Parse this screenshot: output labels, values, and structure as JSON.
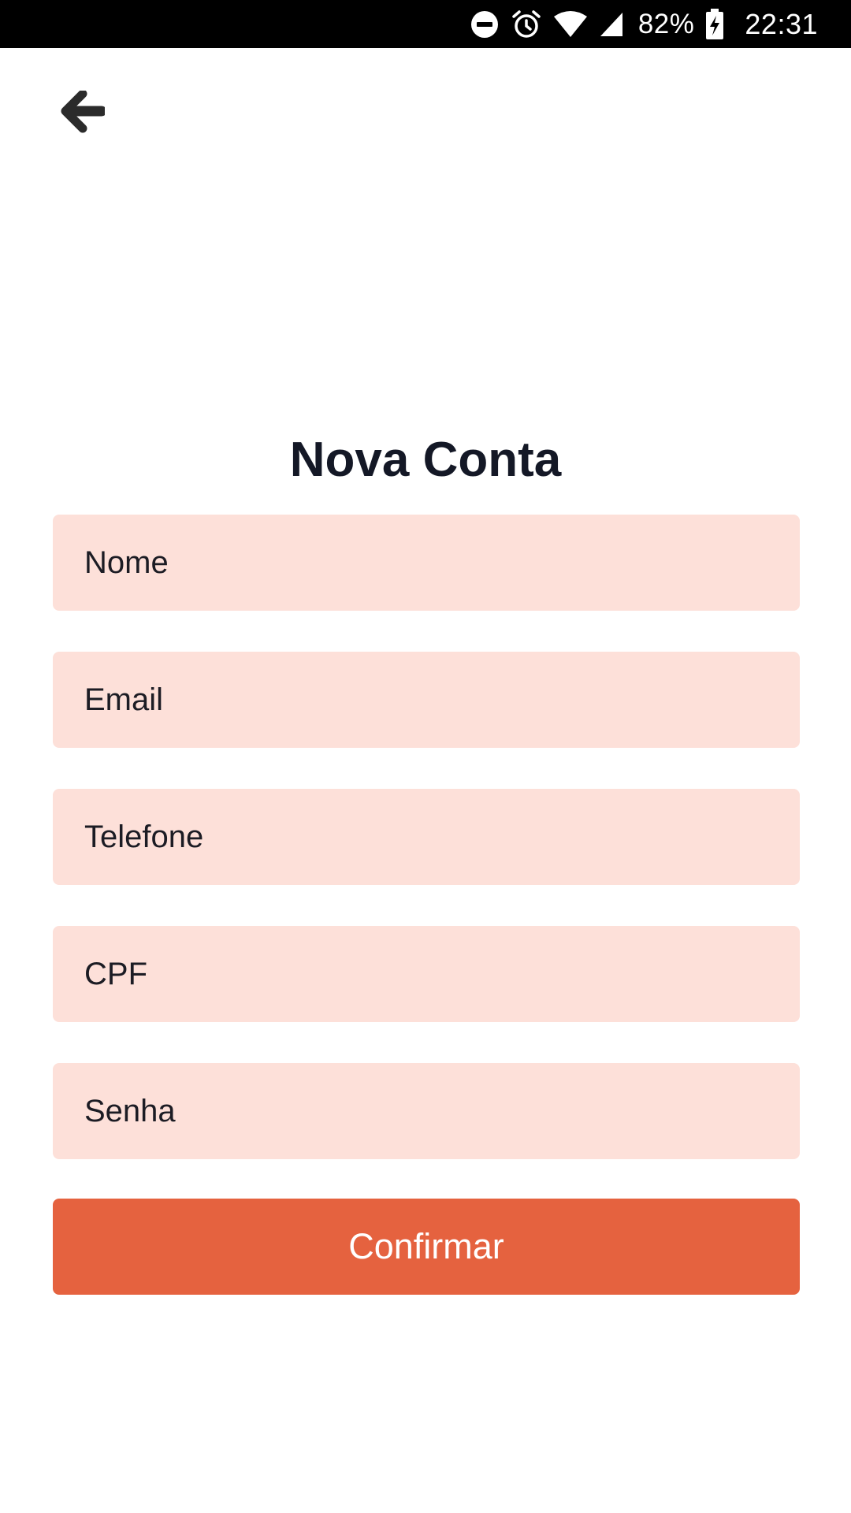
{
  "status_bar": {
    "battery_percent": "82%",
    "time": "22:31",
    "icons": [
      "do-not-disturb-icon",
      "alarm-icon",
      "wifi-icon",
      "cell-signal-icon",
      "battery-charging-icon"
    ]
  },
  "header": {
    "back_icon": "arrow-left-icon"
  },
  "page": {
    "title": "Nova Conta"
  },
  "form": {
    "fields": [
      {
        "name": "nome",
        "placeholder": "Nome",
        "value": ""
      },
      {
        "name": "email",
        "placeholder": "Email",
        "value": ""
      },
      {
        "name": "telefone",
        "placeholder": "Telefone",
        "value": ""
      },
      {
        "name": "cpf",
        "placeholder": "CPF",
        "value": ""
      },
      {
        "name": "senha",
        "placeholder": "Senha",
        "value": ""
      }
    ],
    "submit_label": "Confirmar"
  },
  "colors": {
    "field_background": "#fde0d9",
    "accent": "#e5623f",
    "title": "#141826"
  }
}
